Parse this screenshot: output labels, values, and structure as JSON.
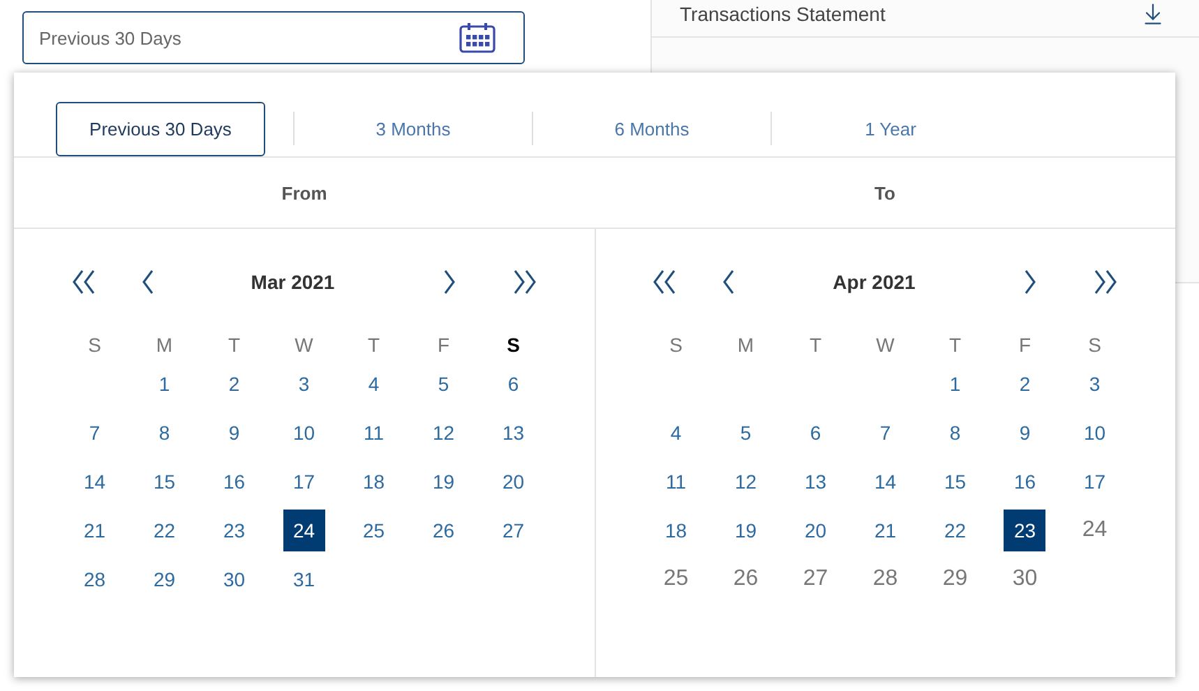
{
  "date_field": {
    "value": "Previous 30 Days"
  },
  "statement": {
    "title": "Transactions Statement"
  },
  "presets": [
    {
      "label": "Previous 30 Days",
      "selected": true
    },
    {
      "label": "3 Months",
      "selected": false
    },
    {
      "label": "6 Months",
      "selected": false
    },
    {
      "label": "1 Year",
      "selected": false
    }
  ],
  "range_headers": [
    "From",
    "To"
  ],
  "calendars": [
    {
      "month": "Mar 2021",
      "weekdays": [
        {
          "label": "S",
          "highlighted": false
        },
        {
          "label": "M",
          "highlighted": false
        },
        {
          "label": "T",
          "highlighted": false
        },
        {
          "label": "W",
          "highlighted": false
        },
        {
          "label": "T",
          "highlighted": false
        },
        {
          "label": "F",
          "highlighted": false
        },
        {
          "label": "S",
          "highlighted": true
        }
      ],
      "weeks": [
        {
          "kind": "lead",
          "days": [
            {
              "day": "1",
              "selected": false,
              "disabled": false
            },
            {
              "day": "2",
              "selected": false,
              "disabled": false
            },
            {
              "day": "3",
              "selected": false,
              "disabled": false
            },
            {
              "day": "4",
              "selected": false,
              "disabled": false
            },
            {
              "day": "5",
              "selected": false,
              "disabled": false
            },
            {
              "day": "6",
              "selected": false,
              "disabled": false
            }
          ]
        },
        {
          "kind": "full",
          "days": [
            {
              "day": "7",
              "selected": false,
              "disabled": false
            },
            {
              "day": "8",
              "selected": false,
              "disabled": false
            },
            {
              "day": "9",
              "selected": false,
              "disabled": false
            },
            {
              "day": "10",
              "selected": false,
              "disabled": false
            },
            {
              "day": "11",
              "selected": false,
              "disabled": false
            },
            {
              "day": "12",
              "selected": false,
              "disabled": false
            },
            {
              "day": "13",
              "selected": false,
              "disabled": false
            }
          ]
        },
        {
          "kind": "full",
          "days": [
            {
              "day": "14",
              "selected": false,
              "disabled": false
            },
            {
              "day": "15",
              "selected": false,
              "disabled": false
            },
            {
              "day": "16",
              "selected": false,
              "disabled": false
            },
            {
              "day": "17",
              "selected": false,
              "disabled": false
            },
            {
              "day": "18",
              "selected": false,
              "disabled": false
            },
            {
              "day": "19",
              "selected": false,
              "disabled": false
            },
            {
              "day": "20",
              "selected": false,
              "disabled": false
            }
          ]
        },
        {
          "kind": "full",
          "days": [
            {
              "day": "21",
              "selected": false,
              "disabled": false
            },
            {
              "day": "22",
              "selected": false,
              "disabled": false
            },
            {
              "day": "23",
              "selected": false,
              "disabled": false
            },
            {
              "day": "24",
              "selected": true,
              "disabled": false
            },
            {
              "day": "25",
              "selected": false,
              "disabled": false
            },
            {
              "day": "26",
              "selected": false,
              "disabled": false
            },
            {
              "day": "27",
              "selected": false,
              "disabled": false
            }
          ]
        },
        {
          "kind": "tail",
          "days": [
            {
              "day": "28",
              "selected": false,
              "disabled": false
            },
            {
              "day": "29",
              "selected": false,
              "disabled": false
            },
            {
              "day": "30",
              "selected": false,
              "disabled": false
            },
            {
              "day": "31",
              "selected": false,
              "disabled": false
            }
          ]
        }
      ]
    },
    {
      "month": "Apr 2021",
      "weekdays": [
        {
          "label": "S",
          "highlighted": false
        },
        {
          "label": "M",
          "highlighted": false
        },
        {
          "label": "T",
          "highlighted": false
        },
        {
          "label": "W",
          "highlighted": false
        },
        {
          "label": "T",
          "highlighted": false
        },
        {
          "label": "F",
          "highlighted": false
        },
        {
          "label": "S",
          "highlighted": false
        }
      ],
      "weeks": [
        {
          "kind": "lead",
          "days": [
            {
              "day": "1",
              "selected": false,
              "disabled": false
            },
            {
              "day": "2",
              "selected": false,
              "disabled": false
            },
            {
              "day": "3",
              "selected": false,
              "disabled": false
            }
          ]
        },
        {
          "kind": "full",
          "days": [
            {
              "day": "4",
              "selected": false,
              "disabled": false
            },
            {
              "day": "5",
              "selected": false,
              "disabled": false
            },
            {
              "day": "6",
              "selected": false,
              "disabled": false
            },
            {
              "day": "7",
              "selected": false,
              "disabled": false
            },
            {
              "day": "8",
              "selected": false,
              "disabled": false
            },
            {
              "day": "9",
              "selected": false,
              "disabled": false
            },
            {
              "day": "10",
              "selected": false,
              "disabled": false
            }
          ]
        },
        {
          "kind": "full",
          "days": [
            {
              "day": "11",
              "selected": false,
              "disabled": false
            },
            {
              "day": "12",
              "selected": false,
              "disabled": false
            },
            {
              "day": "13",
              "selected": false,
              "disabled": false
            },
            {
              "day": "14",
              "selected": false,
              "disabled": false
            },
            {
              "day": "15",
              "selected": false,
              "disabled": false
            },
            {
              "day": "16",
              "selected": false,
              "disabled": false
            },
            {
              "day": "17",
              "selected": false,
              "disabled": false
            }
          ]
        },
        {
          "kind": "full",
          "days": [
            {
              "day": "18",
              "selected": false,
              "disabled": false
            },
            {
              "day": "19",
              "selected": false,
              "disabled": false
            },
            {
              "day": "20",
              "selected": false,
              "disabled": false
            },
            {
              "day": "21",
              "selected": false,
              "disabled": false
            },
            {
              "day": "22",
              "selected": false,
              "disabled": false
            },
            {
              "day": "23",
              "selected": true,
              "disabled": false
            },
            {
              "day": "24",
              "selected": false,
              "disabled": true
            }
          ]
        },
        {
          "kind": "tail",
          "days": [
            {
              "day": "25",
              "selected": false,
              "disabled": true
            },
            {
              "day": "26",
              "selected": false,
              "disabled": true
            },
            {
              "day": "27",
              "selected": false,
              "disabled": true
            },
            {
              "day": "28",
              "selected": false,
              "disabled": true
            },
            {
              "day": "29",
              "selected": false,
              "disabled": true
            },
            {
              "day": "30",
              "selected": false,
              "disabled": true
            }
          ]
        }
      ]
    }
  ]
}
